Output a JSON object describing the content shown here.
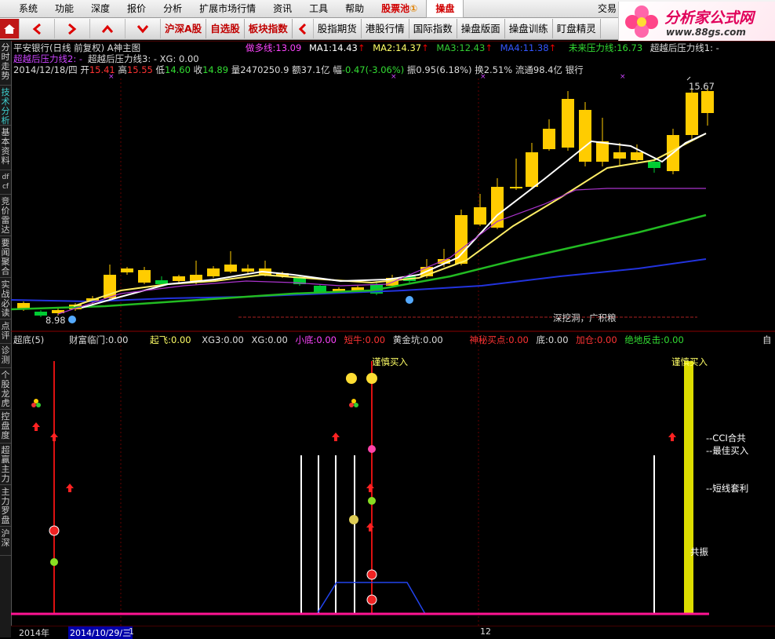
{
  "menu": {
    "items": [
      "系统",
      "功能",
      "深度",
      "报价",
      "分析",
      "扩展市场行情",
      "资讯",
      "工具",
      "帮助"
    ],
    "stock_pool": "股票池",
    "stock_pool_badge": "①",
    "trade_alt": "操盘",
    "trade": "交易"
  },
  "logo": {
    "title": "分析家公式网",
    "url": "www.88gs.com"
  },
  "toolbar": {
    "items": [
      "沪深A股",
      "自选股",
      "板块指数",
      "股指期货",
      "港股行情",
      "国际指数",
      "操盘版面",
      "操盘训练",
      "盯盘精灵"
    ]
  },
  "sidebar": {
    "items": [
      "分时走势",
      "技术分析",
      "基本资料",
      "df cf",
      "竞价雷达",
      "要闻聚合",
      "实战必读",
      "点评",
      "诊测",
      "个股龙虎",
      "控盘度",
      "超赢主力",
      "主力罗盘",
      "沪深"
    ]
  },
  "header": {
    "title": "平安银行(日线 前复权) A神主图",
    "lines": [
      {
        "label": "做多线:",
        "value": "13.09",
        "color": "#ff44ff"
      },
      {
        "label": "MA1:",
        "value": "14.43",
        "color": "#ffffff"
      },
      {
        "label": "MA2:",
        "value": "14.37",
        "color": "#ffff66"
      },
      {
        "label": "MA3:",
        "value": "12.43",
        "color": "#33cc33"
      },
      {
        "label": "MA4:",
        "value": "11.38",
        "color": "#3355ff"
      },
      {
        "label": "未来压力线:",
        "value": "16.73",
        "color": "#33dd33"
      }
    ],
    "ext_label": "超越后压力线1: -",
    "ext2_label": "超越后压力线2: -",
    "ext3": "超越后压力线3: -",
    "xg": "XG: 0.00",
    "ohlc": {
      "date": "2014/12/18/四",
      "open_label": "开",
      "open": "15.41",
      "high_label": "高",
      "high": "15.55",
      "low_label": "低",
      "low": "14.60",
      "close_label": "收",
      "close": "14.89",
      "vol_label": "量",
      "vol": "2470250.9",
      "amt_label": "额",
      "amt": "37.1亿",
      "chg_label": "幅",
      "chg": "-0.47(-3.06%)",
      "amp_label": "振",
      "amp": "0.95(6.18%)",
      "turn_label": "换",
      "turn": "2.51%",
      "float_label": "流通",
      "float": "98.4亿",
      "sector": "银行"
    },
    "high_mark": "15.67",
    "low_mark": "8.98",
    "annotation": "深挖洞，广积粮"
  },
  "indicator": {
    "title": "超底(5)",
    "items": [
      {
        "label": "财富临门:",
        "value": "0.00",
        "color": "#dddddd"
      },
      {
        "label": "起飞:",
        "value": "0.00",
        "color": "#ffff66"
      },
      {
        "label": "XG3:",
        "value": "0.00",
        "color": "#dddddd"
      },
      {
        "label": "XG:",
        "value": "0.00",
        "color": "#dddddd"
      },
      {
        "label": "小底:",
        "value": "0.00",
        "color": "#ff44ff"
      },
      {
        "label": "短牛:",
        "value": "0.00",
        "color": "#ff3333"
      },
      {
        "label": "黄金坑:",
        "value": "0.00",
        "color": "#dddddd"
      },
      {
        "label": "神秘买点:",
        "value": "0.00",
        "color": "#ff3333"
      },
      {
        "label": "底:",
        "value": "0.00",
        "color": "#dddddd"
      },
      {
        "label": "加仓:",
        "value": "0.00",
        "color": "#ff3333"
      },
      {
        "label": "绝地反击:",
        "value": "0.00",
        "color": "#33dd33"
      }
    ],
    "right_char": "自",
    "buy_label_1": "谨慎买入",
    "buy_label_2": "谨慎买入",
    "notes": [
      "--CCI合共",
      "--最佳买入",
      "--短线套利"
    ],
    "side_note": "共振"
  },
  "dates": {
    "year": "2014年",
    "selected": "2014/10/29/三",
    "mid": "1",
    "month": "12"
  },
  "colors": {
    "up": "#ffcc00",
    "down": "#00cc33",
    "accent": "#d00000"
  }
}
